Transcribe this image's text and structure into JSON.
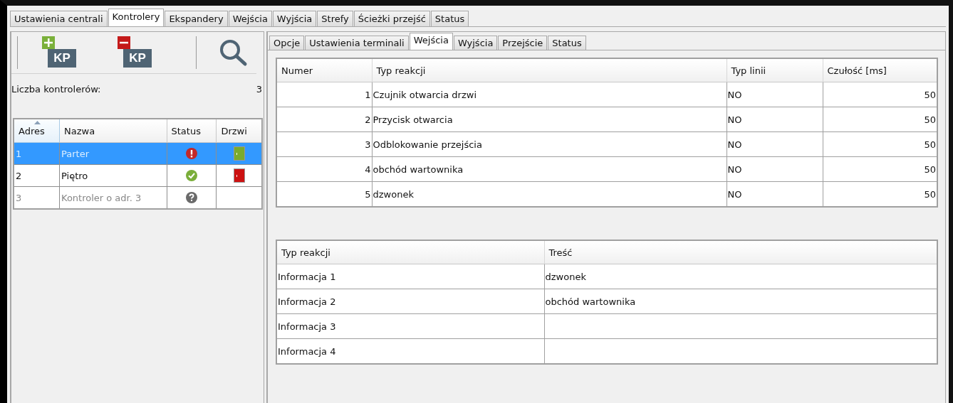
{
  "tabs": [
    {
      "label": "Ustawienia centrali",
      "selected": false
    },
    {
      "label": "Kontrolery",
      "selected": true
    },
    {
      "label": "Ekspandery",
      "selected": false
    },
    {
      "label": "Wejścia",
      "selected": false
    },
    {
      "label": "Wyjścia",
      "selected": false
    },
    {
      "label": "Strefy",
      "selected": false
    },
    {
      "label": "Ścieżki przejść",
      "selected": false
    },
    {
      "label": "Status",
      "selected": false
    }
  ],
  "toolbar": [
    {
      "kind": "add",
      "label": "KP"
    },
    {
      "kind": "remove",
      "label": "KP"
    },
    {
      "kind": "search"
    }
  ],
  "controller_count": {
    "label": "Liczba kontrolerów:",
    "value": "3"
  },
  "controllers": {
    "columns": [
      "Adres",
      "Nazwa",
      "Status",
      "Drzwi"
    ],
    "rows": [
      {
        "address": "1",
        "name": "Parter",
        "status": {
          "kind": "error"
        },
        "door": {
          "color": "#7aab2e"
        },
        "selected": true,
        "disabled": false
      },
      {
        "address": "2",
        "name": "Piętro",
        "status": {
          "kind": "ok"
        },
        "door": {
          "color": "#cc1111"
        },
        "selected": false,
        "disabled": false
      },
      {
        "address": "3",
        "name": "Kontroler o adr. 3",
        "status": {
          "kind": "unknown"
        },
        "selected": false,
        "disabled": true
      }
    ]
  },
  "sub_tabs": [
    {
      "label": "Opcje",
      "selected": false
    },
    {
      "label": "Ustawienia terminali",
      "selected": false
    },
    {
      "label": "Wejścia",
      "selected": true
    },
    {
      "label": "Wyjścia",
      "selected": false
    },
    {
      "label": "Przejście",
      "selected": false
    },
    {
      "label": "Status",
      "selected": false
    }
  ],
  "inputs": {
    "columns": [
      "Numer",
      "Typ reakcji",
      "Typ linii",
      "Czułość [ms]"
    ],
    "rows": [
      [
        "1",
        "Czujnik otwarcia drzwi",
        "NO",
        "50"
      ],
      [
        "2",
        "Przycisk otwarcia",
        "NO",
        "50"
      ],
      [
        "3",
        "Odblokowanie przejścia",
        "NO",
        "50"
      ],
      [
        "4",
        "obchód wartownika",
        "NO",
        "50"
      ],
      [
        "5",
        "dzwonek",
        "NO",
        "50"
      ]
    ]
  },
  "messages": {
    "columns": [
      "Typ reakcji",
      "Treść"
    ],
    "rows": [
      [
        "Informacja 1",
        "dzwonek"
      ],
      [
        "Informacja 2",
        "obchód wartownika"
      ],
      [
        "Informacja 3",
        ""
      ],
      [
        "Informacja 4",
        ""
      ]
    ]
  }
}
